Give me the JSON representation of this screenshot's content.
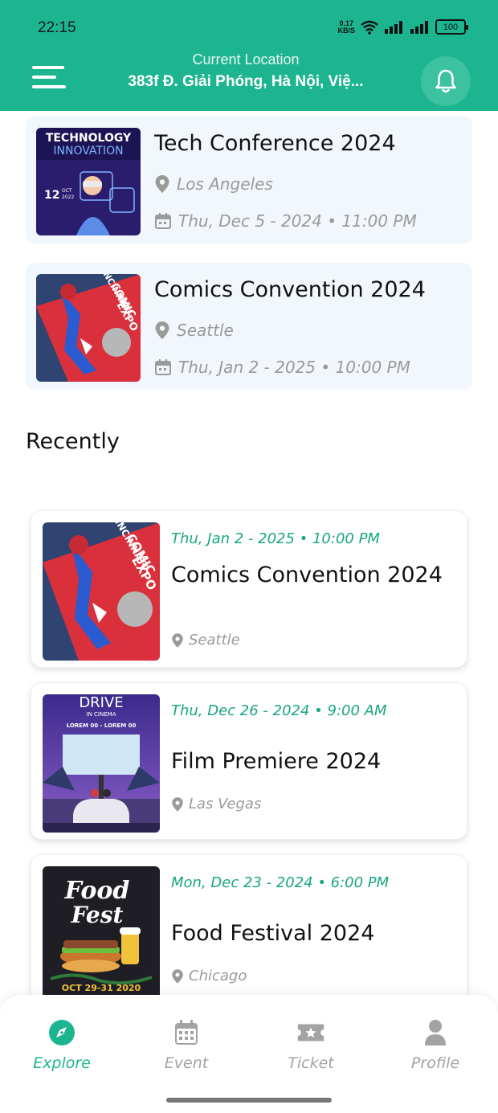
{
  "status_bar": {
    "time": "22:15",
    "net_speed_value": "0.17",
    "net_speed_unit": "KB/S",
    "battery": "100"
  },
  "header": {
    "location_label": "Current Location",
    "location_value": "383f Đ. Giải Phóng, Hà Nội, Việ...",
    "menu_icon": "menu-icon",
    "bell_icon": "bell-icon"
  },
  "colors": {
    "primary": "#1db58f",
    "date_accent": "#1aa684",
    "muted": "#9a9a9a",
    "card_bg": "#f2f7fd"
  },
  "featured_events": [
    {
      "title": "Tech Conference 2024",
      "location": "Los Angeles",
      "datetime": "Thu, Dec 5 - 2024 • 11:00 PM",
      "poster": {
        "line1": "TECHNOLOGY",
        "line2": "INNOVATION",
        "day": "12",
        "month": "OCT",
        "year": "2022"
      }
    },
    {
      "title": "Comics Convention 2024",
      "location": "Seattle",
      "datetime": "Thu, Jan 2 - 2025 • 10:00 PM",
      "poster": {
        "line1": "CINCINNATI",
        "line2": "COMIC",
        "line3": "EXPO"
      }
    }
  ],
  "recent_section_title": "Recently",
  "recent_events": [
    {
      "datetime": "Thu, Jan 2 - 2025 • 10:00 PM",
      "title": "Comics Convention 2024",
      "location": "Seattle",
      "poster": {
        "line1": "CINCINNATI",
        "line2": "COMIC",
        "line3": "EXPO"
      }
    },
    {
      "datetime": "Thu, Dec 26 - 2024 • 9:00 AM",
      "title": "Film Premiere 2024",
      "location": "Las Vegas",
      "poster": {
        "line1": "DRIVE",
        "line2": "IN CINEMA",
        "line3": "LOREM 00 - LOREM 00"
      }
    },
    {
      "datetime": "Mon, Dec 23 - 2024 • 6:00 PM",
      "title": "Food Festival 2024",
      "location": "Chicago",
      "poster": {
        "line1": "Food",
        "line2": "Fest",
        "line3": "OCT 29-31 2020"
      }
    }
  ],
  "bottom_nav": [
    {
      "label": "Explore",
      "icon": "compass-icon",
      "active": true
    },
    {
      "label": "Event",
      "icon": "calendar-icon",
      "active": false
    },
    {
      "label": "Ticket",
      "icon": "ticket-icon",
      "active": false
    },
    {
      "label": "Profile",
      "icon": "person-icon",
      "active": false
    }
  ]
}
